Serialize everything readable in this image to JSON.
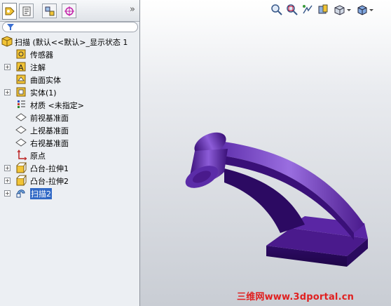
{
  "feature_tree": {
    "root_label": "扫描  (默认<<默认>_显示状态 1",
    "items": [
      {
        "label": "传感器",
        "icon": "sensor-icon",
        "expander": false
      },
      {
        "label": "注解",
        "icon": "annotation-icon",
        "expander": true
      },
      {
        "label": "曲面实体",
        "icon": "surface-bodies-icon",
        "expander": false
      },
      {
        "label": "实体(1)",
        "icon": "solid-bodies-icon",
        "expander": true
      },
      {
        "label": "材质 <未指定>",
        "icon": "material-icon",
        "expander": false
      },
      {
        "label": "前视基准面",
        "icon": "plane-icon",
        "expander": false
      },
      {
        "label": "上视基准面",
        "icon": "plane-icon",
        "expander": false
      },
      {
        "label": "右视基准面",
        "icon": "plane-icon",
        "expander": false
      },
      {
        "label": "原点",
        "icon": "origin-icon",
        "expander": false
      },
      {
        "label": "凸台-拉伸1",
        "icon": "extrude-icon",
        "expander": true
      },
      {
        "label": "凸台-拉伸2",
        "icon": "extrude-icon",
        "expander": true
      },
      {
        "label": "扫描2",
        "icon": "sweep-icon",
        "expander": true,
        "selected": true
      }
    ]
  },
  "tabs": [
    "feature-manager-tab",
    "property-manager-tab",
    "configuration-manager-tab",
    "dimxpert-tab"
  ],
  "tabs_more": "»",
  "watermark": "三维网www.3dportal.cn",
  "colors": {
    "model": "#4a1a8c",
    "selection": "#3169c6",
    "watermark": "#e02020"
  }
}
